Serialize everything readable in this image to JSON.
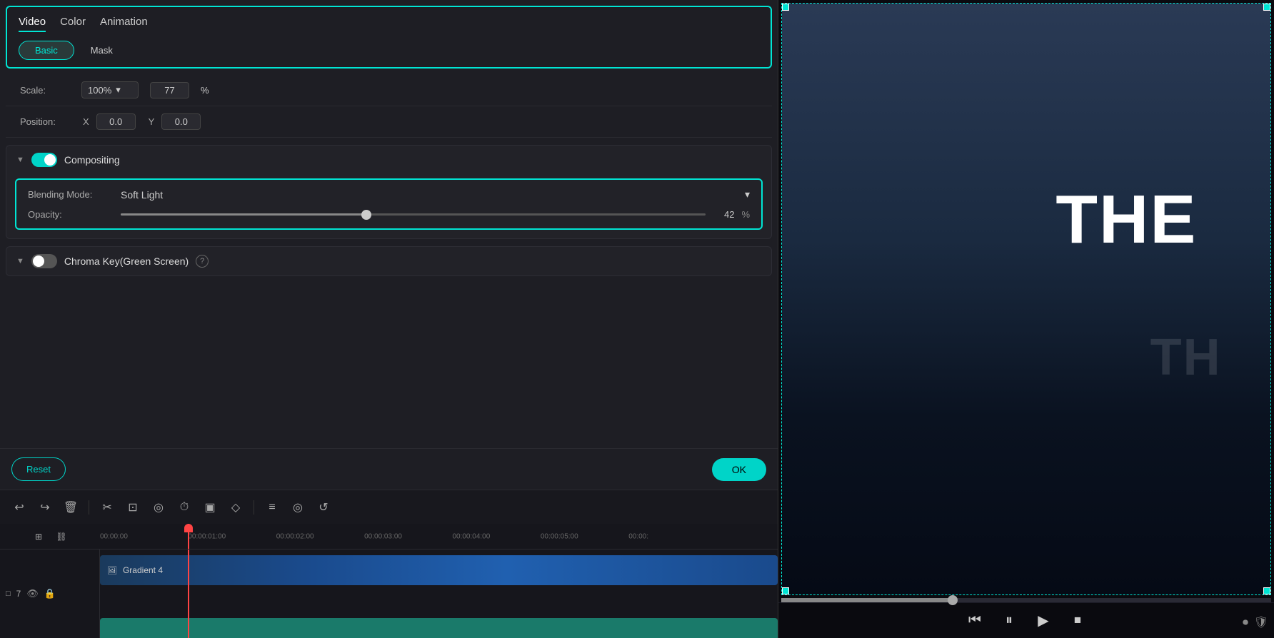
{
  "tabs": {
    "main": [
      {
        "id": "video",
        "label": "Video",
        "active": true
      },
      {
        "id": "color",
        "label": "Color",
        "active": false
      },
      {
        "id": "animation",
        "label": "Animation",
        "active": false
      }
    ],
    "sub": [
      {
        "id": "basic",
        "label": "Basic",
        "active": true
      },
      {
        "id": "mask",
        "label": "Mask",
        "active": false
      }
    ]
  },
  "scale": {
    "label": "Scale:",
    "mode": "100%",
    "value": "77"
  },
  "position": {
    "label": "Position:",
    "x_label": "X",
    "x_value": "0.0",
    "y_label": "Y",
    "y_value": "0.0"
  },
  "compositing": {
    "title": "Compositing",
    "enabled": true,
    "blending": {
      "label": "Blending Mode:",
      "value": "Soft Light"
    },
    "opacity": {
      "label": "Opacity:",
      "value": "42",
      "unit": "%",
      "percent": 42
    }
  },
  "chroma_key": {
    "title": "Chroma Key(Green Screen)",
    "enabled": false
  },
  "buttons": {
    "reset": "Reset",
    "ok": "OK"
  },
  "toolbar": {
    "tools": [
      "↩",
      "↪",
      "🗑",
      "✂",
      "⊡",
      "◎",
      "⏱",
      "▣",
      "◇",
      "≡",
      "◉",
      "↺"
    ]
  },
  "timeline": {
    "markers": [
      {
        "time": "00:00:00",
        "left": "0%"
      },
      {
        "time": "00:00:01:00",
        "left": "12%"
      },
      {
        "time": "00:00:02:00",
        "left": "25%"
      },
      {
        "time": "00:00:03:00",
        "left": "38%"
      },
      {
        "time": "00:00:04:00",
        "left": "51%"
      },
      {
        "time": "00:00:05:00",
        "left": "64%"
      },
      {
        "time": "00:00:",
        "left": "77%"
      }
    ],
    "playhead_position": "12%",
    "track": {
      "number": "7",
      "name": "Gradient 4"
    }
  },
  "preview": {
    "text_main": "THE",
    "text_ghost": "THE"
  }
}
